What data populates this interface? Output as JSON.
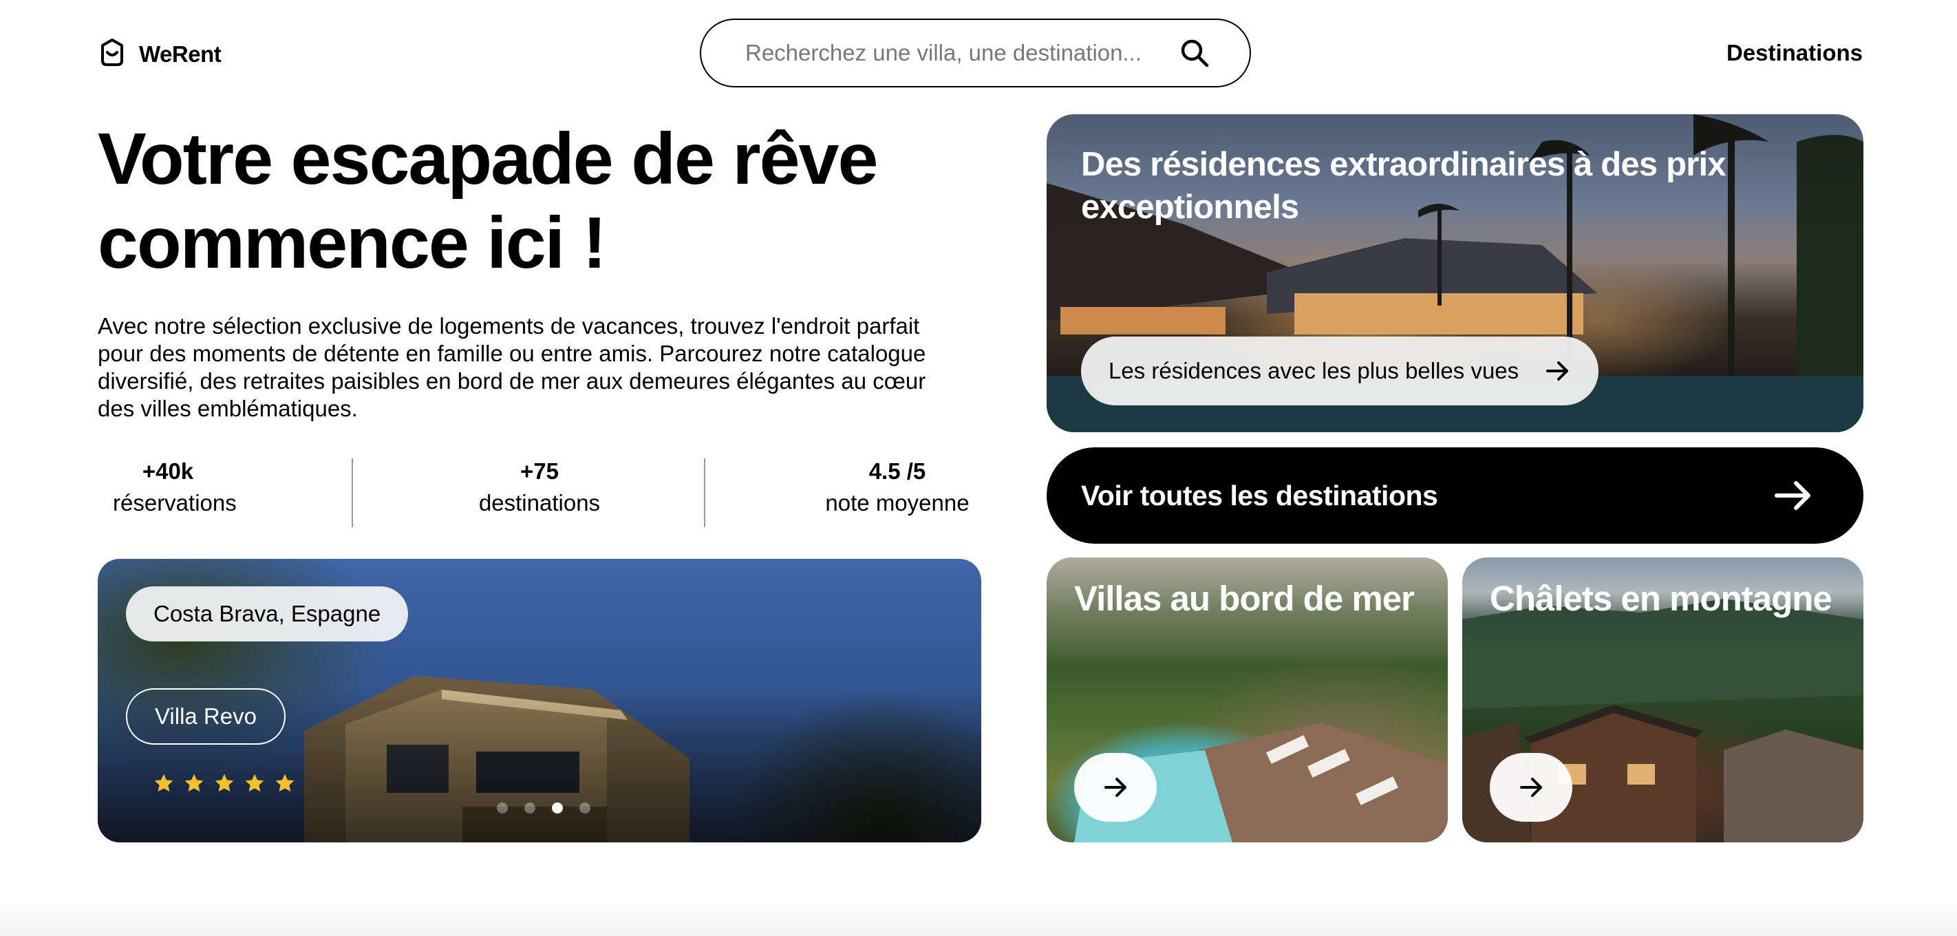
{
  "header": {
    "logo_text": "WeRent",
    "search_placeholder": "Recherchez une villa, une destination...",
    "nav_destinations": "Destinations"
  },
  "hero": {
    "title": "Votre escapade de rêve commence ici !",
    "description": "Avec notre sélection exclusive de logements de vacances, trouvez l'endroit parfait pour des moments de détente en famille ou entre amis. Parcourez notre catalogue diversifié, des retraites paisibles en bord de mer aux demeures élégantes au cœur des villes emblématiques.",
    "stats": [
      {
        "value": "+40k",
        "label": "réservations"
      },
      {
        "value": "+75",
        "label": "destinations"
      },
      {
        "value": "4.5 /5",
        "label": "note moyenne"
      }
    ]
  },
  "carousel": {
    "location": "Costa Brava, Espagne",
    "villa_name": "Villa Revo",
    "rating_stars": 5,
    "slide_count": 4,
    "active_slide": 3
  },
  "featured": {
    "title": "Des résidences extraordinaires à des prix exceptionnels",
    "pill_label": "Les résidences avec les plus belles vues"
  },
  "all_destinations_button": "Voir toutes les destinations",
  "categories": [
    {
      "title": "Villas au bord de mer"
    },
    {
      "title": "Châlets en montagne"
    }
  ],
  "colors": {
    "primary": "#000000",
    "background": "#ffffff",
    "star": "#f5c02e"
  },
  "icons": {
    "logo": "shopping-bag-smile-icon",
    "search": "search-icon",
    "arrow": "arrow-right-icon",
    "star": "star-icon"
  }
}
